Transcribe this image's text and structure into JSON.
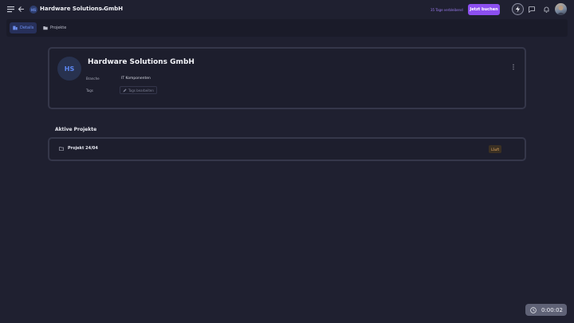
{
  "header": {
    "company_initials": "HS",
    "company_name": "Hardware Solutions GmbH",
    "trial_text": "35 Tage verbleibend",
    "book_button": "Jetzt buchen"
  },
  "tabs": [
    {
      "label": "Details",
      "active": true
    },
    {
      "label": "Projekte",
      "active": false
    }
  ],
  "company": {
    "initials": "HS",
    "name": "Hardware Solutions GmbH",
    "fields": {
      "branche_label": "Branche",
      "branche_value": "IT Komponenten",
      "tags_label": "Tags",
      "tags_button": "Tags bearbeiten"
    }
  },
  "projects": {
    "heading": "Aktive Projekte",
    "items": [
      {
        "name": "Projekt 24/04",
        "status": "Läuft"
      }
    ]
  },
  "timer": {
    "value": "0:00:02"
  },
  "colors": {
    "accent_purple": "#8c4ff0",
    "background": "#1f2030",
    "active_tab": "#6d8ff0",
    "status_running": "#e0a560"
  },
  "icons": [
    "menu-icon",
    "back-icon",
    "chevron-down-icon",
    "bolt-icon",
    "chat-icon",
    "bell-icon",
    "kebab-icon",
    "folder-icon",
    "pencil-icon",
    "timer-icon"
  ]
}
